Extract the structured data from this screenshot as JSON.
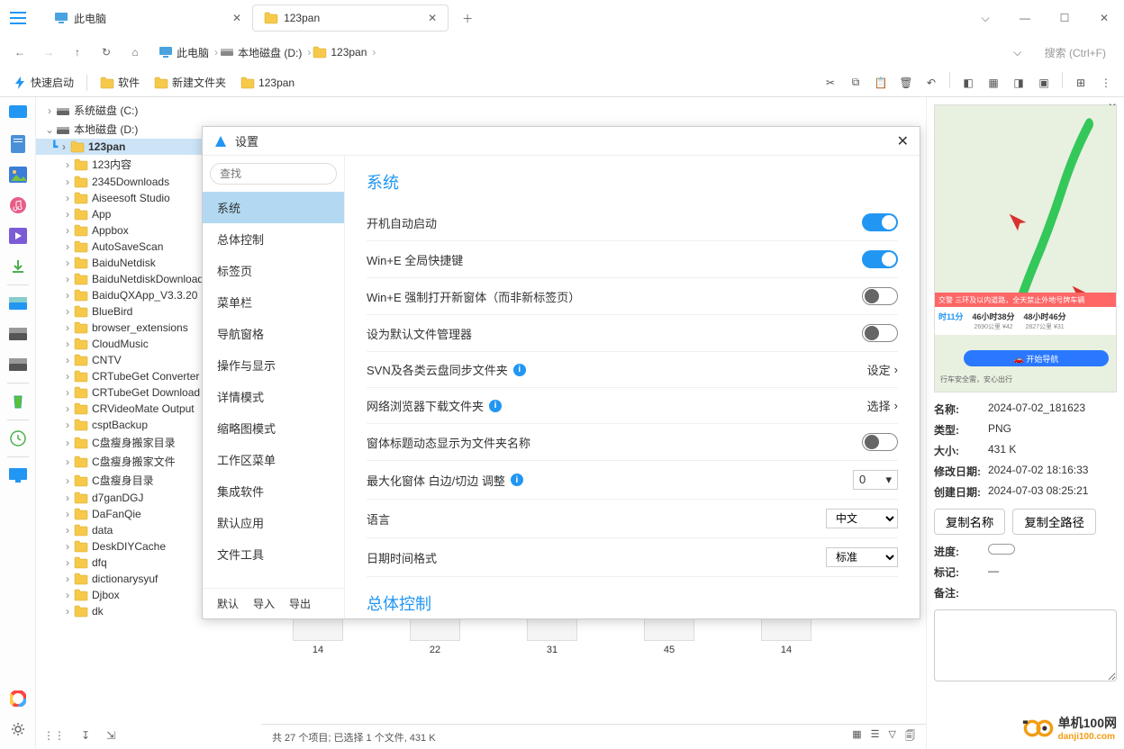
{
  "tabs": [
    {
      "label": "此电脑"
    },
    {
      "label": "123pan"
    }
  ],
  "breadcrumb": {
    "items": [
      "此电脑",
      "本地磁盘 (D:)",
      "123pan"
    ]
  },
  "search": {
    "placeholder": "搜索 (Ctrl+F)"
  },
  "quicklaunch": {
    "label": "快速启动",
    "items": [
      "软件",
      "新建文件夹",
      "123pan"
    ]
  },
  "tree": {
    "roots": [
      {
        "label": "系统磁盘 (C:)",
        "icon": "drive",
        "expand": ">"
      },
      {
        "label": "本地磁盘 (D:)",
        "icon": "drive",
        "expand": "v"
      }
    ],
    "folders": [
      "123pan",
      "123内容",
      "2345Downloads",
      "Aiseesoft Studio",
      "App",
      "Appbox",
      "AutoSaveScan",
      "BaiduNetdisk",
      "BaiduNetdiskDownload",
      "BaiduQXApp_V3.3.20",
      "BlueBird",
      "browser_extensions",
      "CloudMusic",
      "CNTV",
      "CRTubeGet Converter",
      "CRTubeGet Download",
      "CRVideoMate Output",
      "csptBackup",
      "C盘瘦身搬家目录",
      "C盘瘦身搬家文件",
      "C盘瘦身目录",
      "d7ganDGJ",
      "DaFanQie",
      "data",
      "DeskDIYCache",
      "dfq",
      "dictionarysyuf",
      "Djbox",
      "dk"
    ]
  },
  "thumbs": {
    "labels": [
      "14",
      "22",
      "31",
      "45",
      "14"
    ]
  },
  "details": {
    "name_label": "名称:",
    "name": "2024-07-02_181623",
    "type_label": "类型:",
    "type": "PNG",
    "size_label": "大小:",
    "size": "431 K",
    "mod_label": "修改日期:",
    "mod": "2024-07-02  18:16:33",
    "create_label": "创建日期:",
    "create": "2024-07-03  08:25:21",
    "copy_name": "复制名称",
    "copy_path": "复制全路径",
    "progress_label": "进度:",
    "mark_label": "标记:",
    "mark_val": "—",
    "note_label": "备注:"
  },
  "mapbox": {
    "stats": [
      {
        "t": "时11分",
        "s": ""
      },
      {
        "t": "46小时38分",
        "s": "2690公里 ¥42"
      },
      {
        "t": "48小时46分",
        "s": "2827公里 ¥31"
      }
    ],
    "navbtn": "🚗 开始导航",
    "foot": "行车安全需，安心出行"
  },
  "status": {
    "text": "共 27 个项目; 已选择 1 个文件, 431 K"
  },
  "modal": {
    "title": "设置",
    "search_placeholder": "查找",
    "nav": [
      "系统",
      "总体控制",
      "标签页",
      "菜单栏",
      "导航窗格",
      "操作与显示",
      "详情模式",
      "缩略图模式",
      "工作区菜单",
      "集成软件",
      "默认应用",
      "文件工具"
    ],
    "footer": [
      "默认",
      "导入",
      "导出"
    ],
    "section1": "系统",
    "section2": "总体控制",
    "settings": [
      {
        "label": "开机自动启动",
        "ctrl": "toggle",
        "on": true
      },
      {
        "label": "Win+E 全局快捷键",
        "ctrl": "toggle",
        "on": true
      },
      {
        "label": "Win+E 强制打开新窗体（而非新标签页）",
        "ctrl": "toggle",
        "on": false
      },
      {
        "label": "设为默认文件管理器",
        "ctrl": "toggle",
        "on": false
      },
      {
        "label": "SVN及各类云盘同步文件夹",
        "info": true,
        "ctrl": "link",
        "value": "设定"
      },
      {
        "label": "网络浏览器下载文件夹",
        "info": true,
        "ctrl": "link",
        "value": "选择"
      },
      {
        "label": "窗体标题动态显示为文件夹名称",
        "ctrl": "toggle",
        "on": false
      },
      {
        "label": "最大化窗体 白边/切边 调整",
        "info": true,
        "ctrl": "spinner",
        "value": "0"
      },
      {
        "label": "语言",
        "ctrl": "select",
        "value": "中文"
      },
      {
        "label": "日期时间格式",
        "ctrl": "select",
        "value": "标准"
      }
    ]
  },
  "watermark": {
    "top": "单机100网",
    "bot": "danji100.com"
  }
}
